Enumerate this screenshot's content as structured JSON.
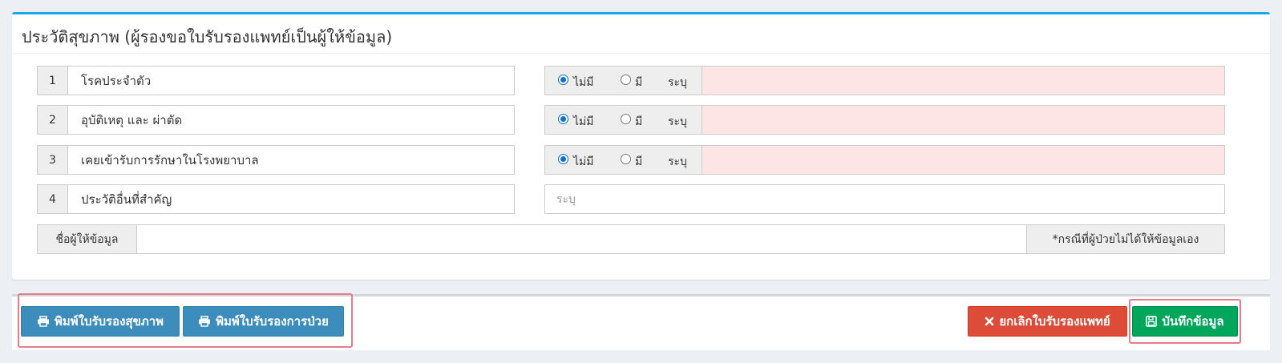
{
  "panel": {
    "title": "ประวัติสุขภาพ (ผู้รองขอใบรับรองแพทย์เป็นผู้ให้ข้อมูล)"
  },
  "history_rows": [
    {
      "num": "1",
      "label": "โรคประจำตัว",
      "opt_none": "ไม่มี",
      "opt_have": "มี",
      "specify": "ระบุ",
      "selected": "none",
      "value": ""
    },
    {
      "num": "2",
      "label": "อุบัติเหตุ และ ผ่าตัด",
      "opt_none": "ไม่มี",
      "opt_have": "มี",
      "specify": "ระบุ",
      "selected": "none",
      "value": ""
    },
    {
      "num": "3",
      "label": "เคยเข้ารับการรักษาในโรงพยาบาล",
      "opt_none": "ไม่มี",
      "opt_have": "มี",
      "specify": "ระบุ",
      "selected": "none",
      "value": ""
    }
  ],
  "other_history": {
    "num": "4",
    "label": "ประวัติอื่นที่สำคัญ",
    "placeholder": "ระบุ",
    "value": ""
  },
  "info_giver": {
    "label": "ชื่อผู้ให้ข้อมูล",
    "value": "",
    "note": "*กรณีที่ผู้ป่วยไม่ได้ให้ข้อมูลเอง"
  },
  "footer": {
    "print_health_label": "พิมพ์ใบรับรองสุขภาพ",
    "print_illness_label": "พิมพ์ใบรับรองการป่วย",
    "cancel_label": "ยกเลิกใบรับรองแพทย์",
    "save_label": "บันทึกข้อมูล"
  },
  "icons": {
    "print": "print-icon",
    "cancel": "close-icon",
    "save": "floppy-disk-icon"
  },
  "colors": {
    "accent": "#16a9e8",
    "primary_button": "#3c8dbc",
    "danger_button": "#dd4b39",
    "success_button": "#00a65a",
    "required_field": "#fde5e5",
    "highlight": "#e57e8a"
  }
}
